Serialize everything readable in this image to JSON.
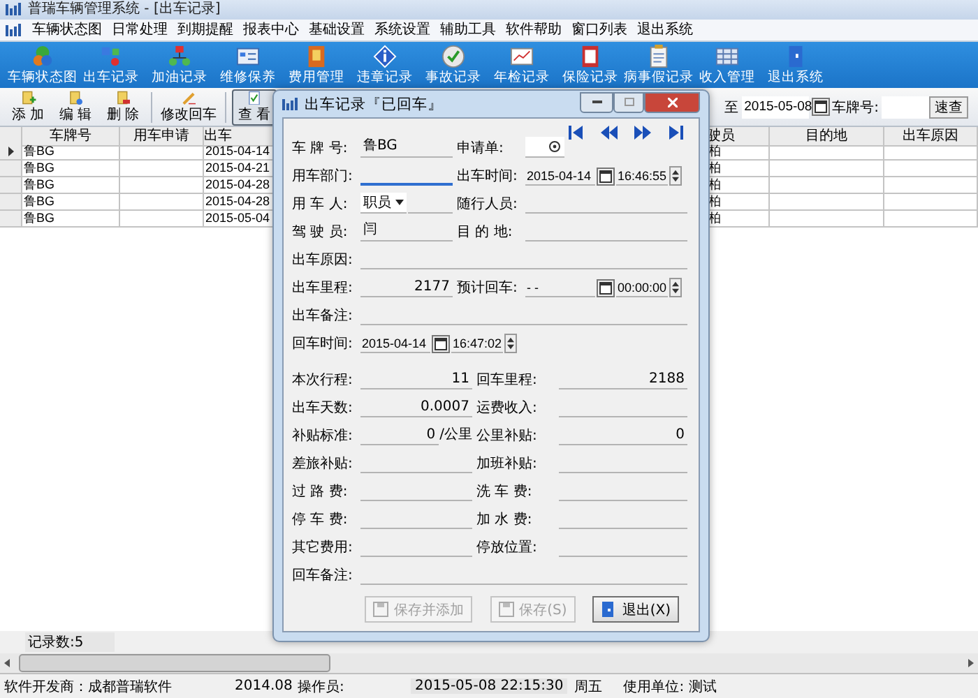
{
  "window": {
    "title": "普瑞车辆管理系统 - [出车记录]"
  },
  "menu": [
    "车辆状态图",
    "日常处理",
    "到期提醒",
    "报表中心",
    "基础设置",
    "系统设置",
    "辅助工具",
    "软件帮助",
    "窗口列表",
    "退出系统"
  ],
  "toolbar": [
    "车辆状态图",
    "出车记录",
    "加油记录",
    "维修保养",
    "费用管理",
    "违章记录",
    "事故记录",
    "年检记录",
    "保险记录",
    "病事假记录",
    "收入管理",
    "退出系统"
  ],
  "actions": [
    {
      "label": "添 加",
      "selected": false
    },
    {
      "label": "编 辑",
      "selected": false
    },
    {
      "label": "删 除",
      "selected": false
    },
    {
      "label": "修改回车",
      "selected": false
    },
    {
      "label": "查 看",
      "selected": true
    }
  ],
  "filter": {
    "to_label": "至",
    "to_date": "2015-05-08",
    "plate_label": "车牌号:",
    "quick_button": "速查"
  },
  "table": {
    "columns": [
      "车牌号",
      "用车申请",
      "出车",
      "驶员",
      "目的地",
      "出车原因"
    ],
    "rows": [
      {
        "selected": true,
        "cells": [
          "鲁BG",
          "",
          "2015-04-14",
          "柏",
          "",
          ""
        ]
      },
      {
        "selected": false,
        "cells": [
          "鲁BG",
          "",
          "2015-04-21",
          "柏",
          "",
          ""
        ]
      },
      {
        "selected": false,
        "cells": [
          "鲁BG",
          "",
          "2015-04-28",
          "柏",
          "",
          ""
        ]
      },
      {
        "selected": false,
        "cells": [
          "鲁BG",
          "",
          "2015-04-28",
          "柏",
          "",
          ""
        ]
      },
      {
        "selected": false,
        "cells": [
          "鲁BG",
          "",
          "2015-05-04",
          "柏",
          "",
          ""
        ]
      }
    ]
  },
  "record_count": "记录数:5",
  "status_bar": {
    "developer": "软件开发商：成都普瑞软件",
    "version": "2014.08",
    "operator_label": "操作员:",
    "datetime": "2015-05-08 22:15:30",
    "weekday": "周五",
    "unit": "使用单位: 测试"
  },
  "dialog": {
    "title": "出车记录『已回车』",
    "sections": [
      {
        "rows": [
          [
            {
              "label": "车 牌 号:",
              "kind": "text",
              "value": "鲁BG",
              "focused": false
            },
            {
              "label": "申请单:",
              "kind": "lookup",
              "focused": false
            }
          ],
          [
            {
              "label": "用车部门:",
              "kind": "text",
              "focused": true
            },
            {
              "label": "出车时间:",
              "kind": "date_time",
              "date": "2015-04-14",
              "time": "16:46:55",
              "focused": false
            }
          ],
          [
            {
              "label": "用 车 人:",
              "kind": "select",
              "value": "职员",
              "focused": false
            },
            {
              "label": "随行人员:",
              "kind": "text",
              "focused": false
            }
          ],
          [
            {
              "label": "驾 驶 员:",
              "kind": "text",
              "value": "闫",
              "focused": false
            },
            {
              "label": "目 的 地:",
              "kind": "text",
              "focused": false
            }
          ],
          [
            {
              "label": "出车原因:",
              "kind": "text",
              "focused": false
            }
          ],
          [
            {
              "label": "出车里程:",
              "kind": "number",
              "value": "2177",
              "focused": false
            },
            {
              "label": "预计回车:",
              "kind": "date_time",
              "date": "-  -",
              "time": "00:00:00",
              "focused": false
            }
          ],
          [
            {
              "label": "出车备注:",
              "kind": "text",
              "focused": false
            }
          ],
          [
            {
              "label": "回车时间:",
              "kind": "date_time",
              "date": "2015-04-14",
              "time": "16:47:02",
              "focused": false
            }
          ]
        ]
      },
      {
        "rows": [
          [
            {
              "label": "本次行程:",
              "kind": "number",
              "value": "11",
              "focused": false
            },
            {
              "label": "回车里程:",
              "kind": "number",
              "value": "2188",
              "focused": false
            }
          ],
          [
            {
              "label": "出车天数:",
              "kind": "number",
              "value": "0.0007",
              "focused": false
            },
            {
              "label": "运费收入:",
              "kind": "number",
              "focused": false
            }
          ],
          [
            {
              "label": "补贴标准:",
              "kind": "number",
              "value": "0",
              "suffix": "/公里",
              "focused": false
            },
            {
              "label": "公里补贴:",
              "kind": "number",
              "value": "0",
              "focused": false
            }
          ],
          [
            {
              "label": "差旅补贴:",
              "kind": "number",
              "focused": false
            },
            {
              "label": "加班补贴:",
              "kind": "number",
              "focused": false
            }
          ],
          [
            {
              "label": "过 路 费:",
              "kind": "number",
              "focused": false
            },
            {
              "label": "洗 车 费:",
              "kind": "number",
              "focused": false
            }
          ],
          [
            {
              "label": "停 车 费:",
              "kind": "number",
              "focused": false
            },
            {
              "label": "加 水 费:",
              "kind": "number",
              "focused": false
            }
          ],
          [
            {
              "label": "其它费用:",
              "kind": "number",
              "focused": false
            },
            {
              "label": "停放位置:",
              "kind": "text",
              "focused": false
            }
          ],
          [
            {
              "label": "回车备注:",
              "kind": "text",
              "focused": false
            }
          ]
        ]
      }
    ],
    "buttons": [
      {
        "label": "保存并添加",
        "disabled": true
      },
      {
        "label": "保存(S)",
        "disabled": true
      },
      {
        "label": "退出(X)",
        "disabled": false
      }
    ]
  }
}
